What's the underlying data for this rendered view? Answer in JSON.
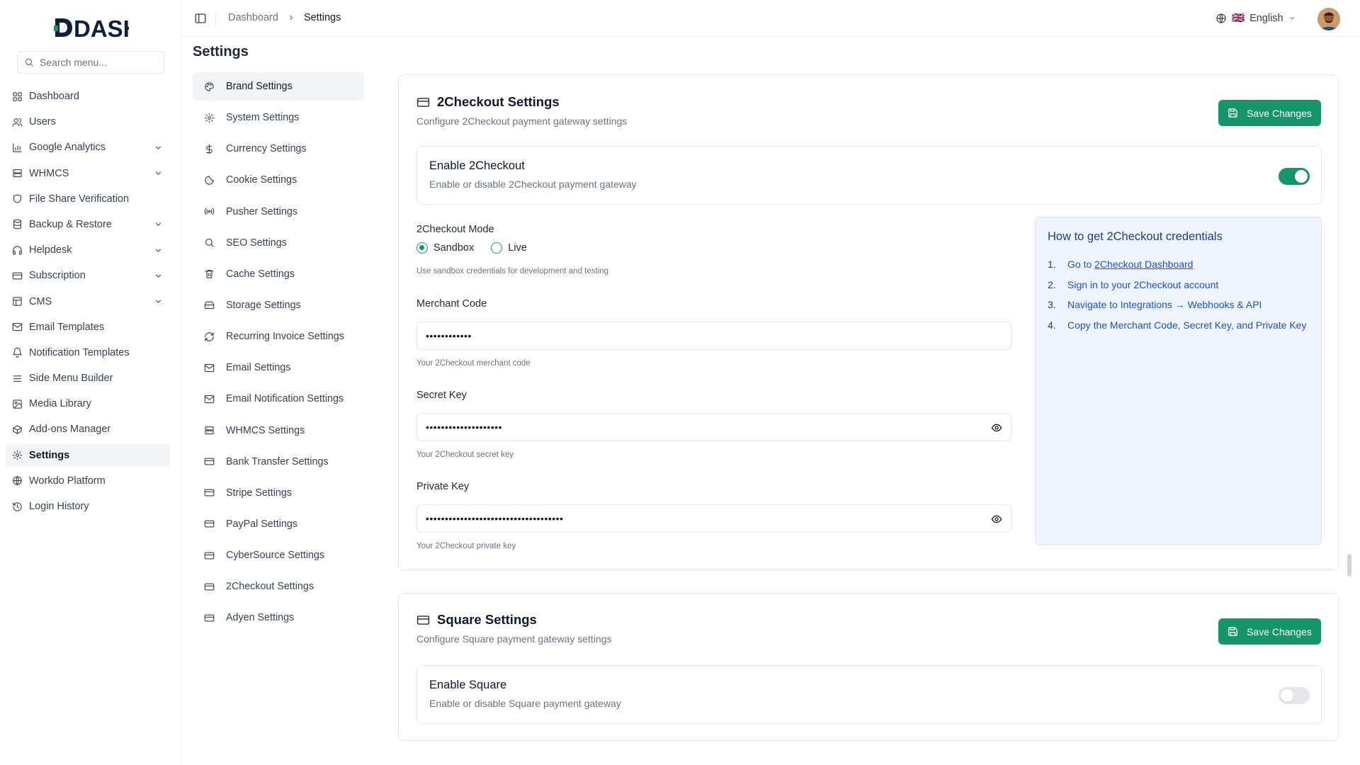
{
  "app": {
    "logo_text": "DASH"
  },
  "sidebar": {
    "search_placeholder": "Search menu...",
    "items": [
      {
        "label": "Dashboard",
        "icon": "grid-icon"
      },
      {
        "label": "Users",
        "icon": "users-icon"
      },
      {
        "label": "Google Analytics",
        "icon": "bar-chart-icon",
        "expandable": true
      },
      {
        "label": "WHMCS",
        "icon": "server-icon",
        "expandable": true
      },
      {
        "label": "File Share Verification",
        "icon": "shield-icon"
      },
      {
        "label": "Backup & Restore",
        "icon": "database-icon",
        "expandable": true
      },
      {
        "label": "Helpdesk",
        "icon": "headphones-icon",
        "expandable": true
      },
      {
        "label": "Subscription",
        "icon": "credit-card-icon",
        "expandable": true
      },
      {
        "label": "CMS",
        "icon": "layout-icon",
        "expandable": true
      },
      {
        "label": "Email Templates",
        "icon": "mail-icon"
      },
      {
        "label": "Notification Templates",
        "icon": "bell-icon"
      },
      {
        "label": "Side Menu Builder",
        "icon": "menu-icon"
      },
      {
        "label": "Media Library",
        "icon": "image-icon"
      },
      {
        "label": "Add-ons Manager",
        "icon": "package-icon"
      },
      {
        "label": "Settings",
        "icon": "gear-icon",
        "active": true
      },
      {
        "label": "Workdo Platform",
        "icon": "globe-icon"
      },
      {
        "label": "Login History",
        "icon": "history-icon"
      }
    ]
  },
  "header": {
    "breadcrumb": [
      "Dashboard",
      "Settings"
    ],
    "language": "English",
    "language_flag": "🇬🇧"
  },
  "page": {
    "title": "Settings"
  },
  "settings_menu": [
    {
      "label": "Brand Settings",
      "icon": "palette-icon",
      "active": true
    },
    {
      "label": "System Settings",
      "icon": "gear-icon"
    },
    {
      "label": "Currency Settings",
      "icon": "dollar-icon"
    },
    {
      "label": "Cookie Settings",
      "icon": "cookie-icon"
    },
    {
      "label": "Pusher Settings",
      "icon": "broadcast-icon"
    },
    {
      "label": "SEO Settings",
      "icon": "search-icon"
    },
    {
      "label": "Cache Settings",
      "icon": "trash-icon"
    },
    {
      "label": "Storage Settings",
      "icon": "hard-drive-icon"
    },
    {
      "label": "Recurring Invoice Settings",
      "icon": "refresh-icon"
    },
    {
      "label": "Email Settings",
      "icon": "mail-icon"
    },
    {
      "label": "Email Notification Settings",
      "icon": "mail-icon"
    },
    {
      "label": "WHMCS Settings",
      "icon": "server-icon"
    },
    {
      "label": "Bank Transfer Settings",
      "icon": "credit-card-icon"
    },
    {
      "label": "Stripe Settings",
      "icon": "credit-card-icon"
    },
    {
      "label": "PayPal Settings",
      "icon": "credit-card-icon"
    },
    {
      "label": "CyberSource Settings",
      "icon": "credit-card-icon"
    },
    {
      "label": "2Checkout Settings",
      "icon": "credit-card-icon"
    },
    {
      "label": "Adyen Settings",
      "icon": "credit-card-icon"
    }
  ],
  "checkout": {
    "title": "2Checkout Settings",
    "subtitle": "Configure 2Checkout payment gateway settings",
    "save_label": "Save Changes",
    "enable_title": "Enable 2Checkout",
    "enable_desc": "Enable or disable 2Checkout payment gateway",
    "enabled": true,
    "mode_label": "2Checkout Mode",
    "mode_options": [
      "Sandbox",
      "Live"
    ],
    "mode_selected": "Sandbox",
    "mode_hint": "Use sandbox credentials for development and testing",
    "merchant_label": "Merchant Code",
    "merchant_value": "••••••••••••",
    "merchant_hint": "Your 2Checkout merchant code",
    "secret_label": "Secret Key",
    "secret_value": "••••••••••••••••••••",
    "secret_hint": "Your 2Checkout secret key",
    "private_label": "Private Key",
    "private_value": "••••••••••••••••••••••••••••••••••••",
    "private_hint": "Your 2Checkout private key",
    "help": {
      "title": "How to get 2Checkout credentials",
      "steps": [
        {
          "num": "1.",
          "text": "Go to ",
          "link": "2Checkout Dashboard"
        },
        {
          "num": "2.",
          "text": "Sign in to your 2Checkout account"
        },
        {
          "num": "3.",
          "text": "Navigate to Integrations → Webhooks & API"
        },
        {
          "num": "4.",
          "text": "Copy the Merchant Code, Secret Key, and Private Key"
        }
      ]
    }
  },
  "square": {
    "title": "Square Settings",
    "subtitle": "Configure Square payment gateway settings",
    "save_label": "Save Changes",
    "enable_title": "Enable Square",
    "enable_desc": "Enable or disable Square payment gateway",
    "enabled": false
  },
  "colors": {
    "accent": "#16946a",
    "info_bg": "#eff5fd",
    "info_text": "#1d4ed8"
  }
}
